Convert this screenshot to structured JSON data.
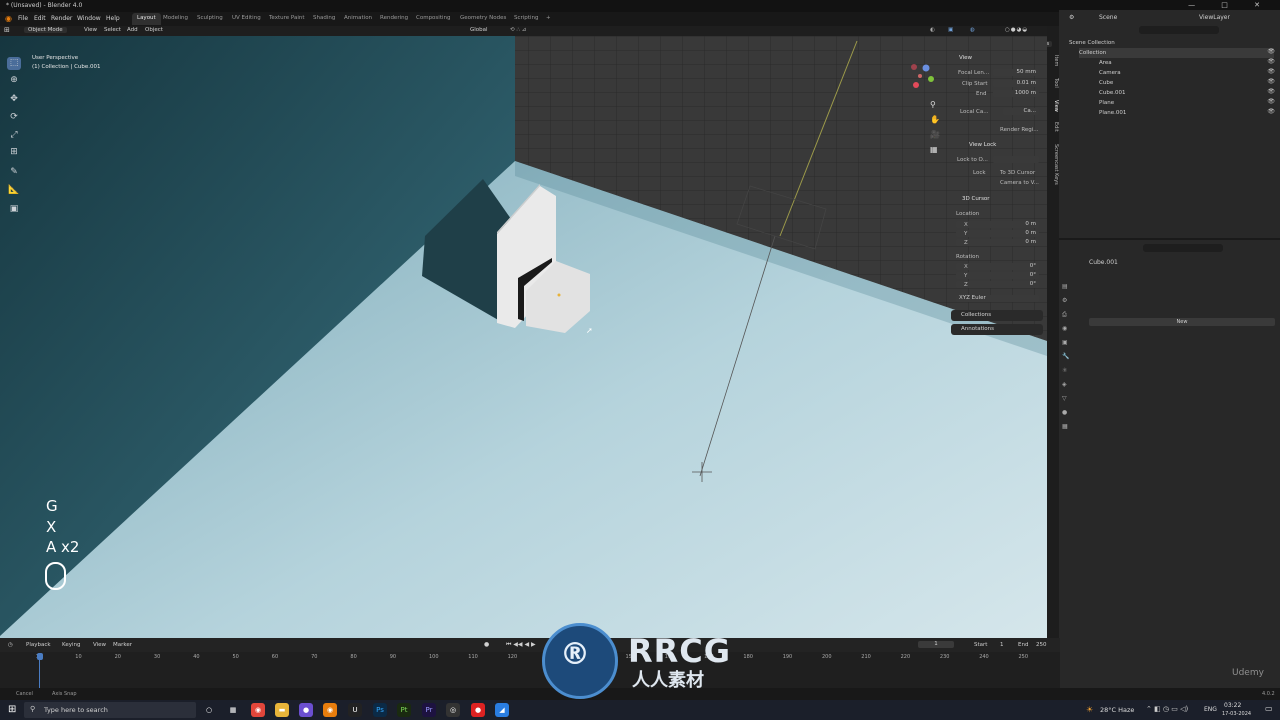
{
  "window": {
    "title": "* (Unsaved) - Blender 4.0",
    "controls": "— □ ✕"
  },
  "menus": [
    "File",
    "Edit",
    "Render",
    "Window",
    "Help"
  ],
  "workspaces": [
    "Layout",
    "Modeling",
    "Sculpting",
    "UV Editing",
    "Texture Paint",
    "Shading",
    "Animation",
    "Rendering",
    "Compositing",
    "Geometry Nodes",
    "Scripting",
    "+"
  ],
  "scene": {
    "scene_label": "Scene",
    "viewlayer_label": "ViewLayer"
  },
  "viewport_header": {
    "mode": "Object Mode",
    "menus": [
      "View",
      "Select",
      "Add",
      "Object"
    ],
    "orientation": "Global",
    "options": "Options"
  },
  "viewport": {
    "perspective": "User Perspective",
    "collection": "(1) Collection | Cube.001"
  },
  "keys": {
    "k1": "G",
    "k2": "X",
    "k3": "A x2"
  },
  "npanel": {
    "view_title": "View",
    "focal_label": "Focal Len...",
    "focal_value": "50 mm",
    "clip_start_label": "Clip Start",
    "clip_start_value": "0.01 m",
    "end_label": "End",
    "end_value": "1000 m",
    "local_cam_label": "Local Ca...",
    "local_cam_value": "Ca...",
    "render_region": "Render Regi...",
    "view_lock_title": "View Lock",
    "lock_to_label": "Lock to O...",
    "lock_label": "Lock",
    "to_3d_cursor": "To 3D Cursor",
    "camera_to_view": "Camera to V...",
    "cursor_title": "3D Cursor",
    "location_label": "Location",
    "loc_x": "0 m",
    "loc_y": "0 m",
    "loc_z": "0 m",
    "rotation_label": "Rotation",
    "rot_x": "0°",
    "rot_y": "0°",
    "rot_z": "0°",
    "axis_x": "X",
    "axis_y": "Y",
    "axis_z": "Z",
    "euler": "XYZ Euler",
    "collections": "Collections",
    "annotations": "Annotations"
  },
  "vtabs": [
    "Item",
    "Tool",
    "View",
    "Edit",
    "Screencast Keys"
  ],
  "outliner": {
    "root": "Scene Collection",
    "collection": "Collection",
    "items": [
      "Area",
      "Camera",
      "Cube",
      "Cube.001",
      "Plane",
      "Plane.001"
    ]
  },
  "properties": {
    "object_name": "Cube.001",
    "new_button": "New"
  },
  "timeline": {
    "menus": [
      "Playback",
      "Keying",
      "View",
      "Marker"
    ],
    "current_frame": "1",
    "start_label": "Start",
    "start_value": "1",
    "end_label": "End",
    "end_value": "250",
    "frame_ticks": [
      "1",
      "10",
      "20",
      "30",
      "40",
      "50",
      "60",
      "70",
      "80",
      "90",
      "100",
      "110",
      "120",
      "130",
      "140",
      "150",
      "160",
      "170",
      "180",
      "190",
      "200",
      "210",
      "220",
      "230",
      "240",
      "250"
    ]
  },
  "status": {
    "left": "Cancel",
    "left2": "Axis Snap",
    "version": "4.0.2"
  },
  "taskbar": {
    "search_placeholder": "Type here to search",
    "weather": "28°C Haze",
    "lang": "ENG",
    "time": "03:22",
    "date": "17-03-2024"
  },
  "watermark": {
    "logo_text": "RRCG",
    "sub_text": "人人素材",
    "brand": "Udemy"
  },
  "colors": {
    "accent": "#4a6d9a",
    "floor": "#8fb8c6",
    "wall": "#2c5560",
    "grid_wall": "#3a3a3a"
  }
}
